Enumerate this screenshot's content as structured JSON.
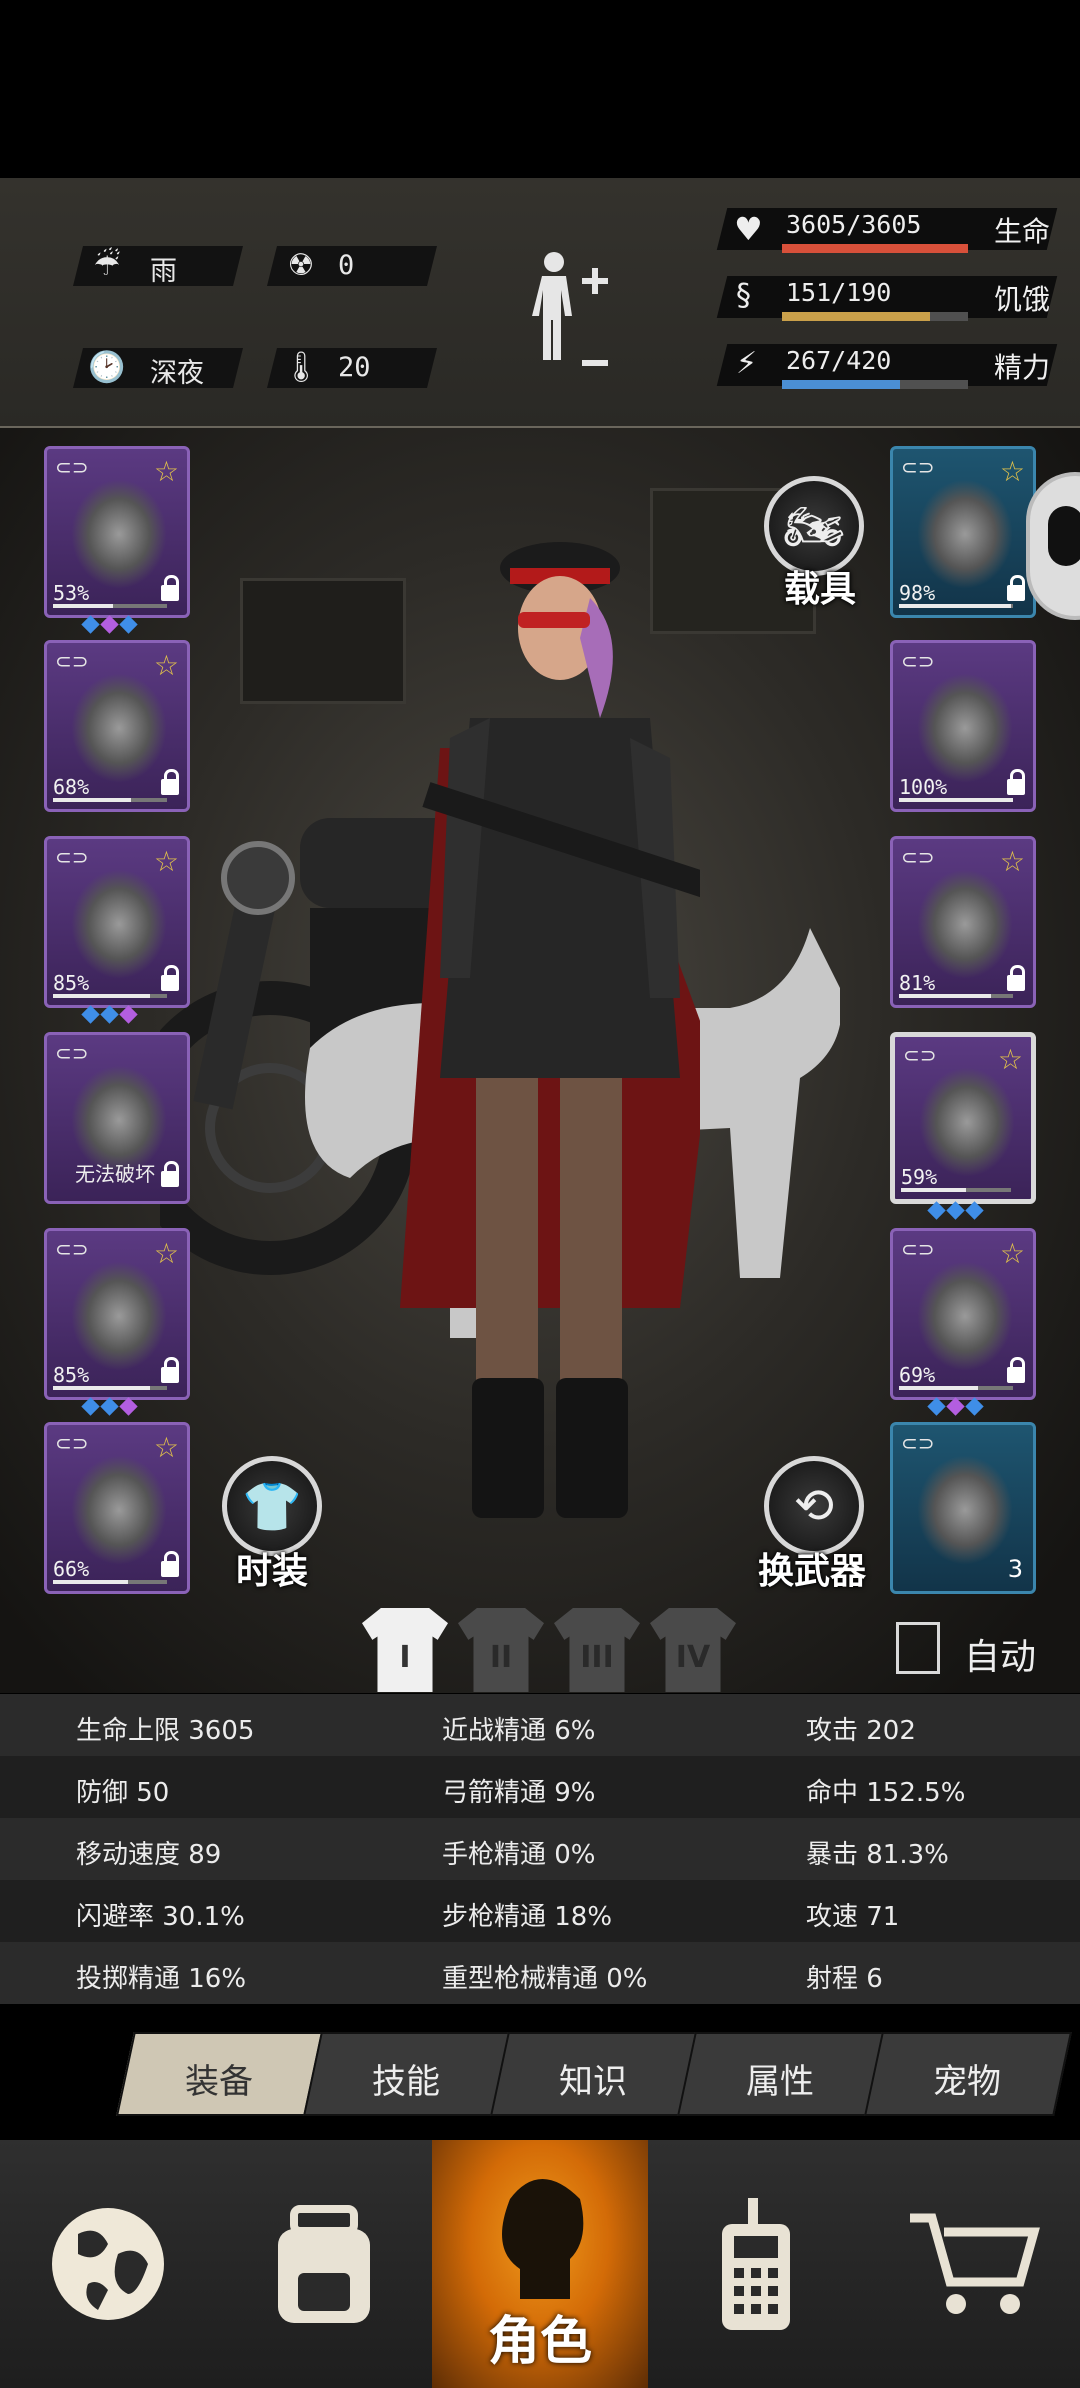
{
  "environment": {
    "weather": "雨",
    "radiation": "0",
    "time_of_day": "深夜",
    "temperature": "20"
  },
  "vitals": {
    "life": {
      "value": "3605/3605",
      "label": "生命",
      "fraction": 1.0,
      "color": "#d8503a"
    },
    "hunger": {
      "value": "151/190",
      "label": "饥饿",
      "fraction": 0.795,
      "color": "#caa04a"
    },
    "energy": {
      "value": "267/420",
      "label": "精力",
      "fraction": 0.636,
      "color": "#4b8fd4"
    }
  },
  "equipment_left": [
    {
      "name": "police-helmet",
      "pct": "53%",
      "durability": 0.53,
      "starred": true,
      "locked": true,
      "gems": [
        "b",
        "p",
        "b"
      ]
    },
    {
      "name": "jacket",
      "pct": "68%",
      "durability": 0.68,
      "starred": true,
      "locked": true,
      "gems": []
    },
    {
      "name": "coat",
      "pct": "85%",
      "durability": 0.85,
      "starred": true,
      "locked": true,
      "gems": [
        "b",
        "b",
        "p"
      ]
    },
    {
      "name": "backpack",
      "pct": "无法破坏",
      "durability": 1.0,
      "starred": false,
      "locked": true,
      "gems": []
    },
    {
      "name": "pants",
      "pct": "85%",
      "durability": 0.85,
      "starred": true,
      "locked": true,
      "gems": [
        "b",
        "b",
        "p"
      ]
    },
    {
      "name": "boots",
      "pct": "66%",
      "durability": 0.66,
      "starred": true,
      "locked": true,
      "gems": []
    }
  ],
  "equipment_right": [
    {
      "name": "sunglasses",
      "pct": "98%",
      "durability": 0.98,
      "starred": true,
      "locked": true,
      "gems": []
    },
    {
      "name": "gas-mask",
      "pct": "100%",
      "durability": 1.0,
      "starred": false,
      "locked": true,
      "gems": []
    },
    {
      "name": "tactical-vest",
      "pct": "81%",
      "durability": 0.81,
      "starred": true,
      "locked": true,
      "gems": []
    },
    {
      "name": "assault-rifle",
      "pct": "59%",
      "durability": 0.59,
      "starred": true,
      "locked": false,
      "gems": [
        "b",
        "b",
        "b"
      ]
    },
    {
      "name": "katana",
      "pct": "69%",
      "durability": 0.69,
      "starred": true,
      "locked": true,
      "gems": [
        "b",
        "p",
        "b"
      ]
    },
    {
      "name": "pouch",
      "count": "3"
    }
  ],
  "buttons": {
    "vehicle": "载具",
    "fashion": "时装",
    "swap_weapon": "换武器",
    "auto": "自动"
  },
  "loadouts": [
    "I",
    "II",
    "III",
    "IV"
  ],
  "stats": [
    [
      "生命上限 3605",
      "近战精通 6%",
      "攻击 202"
    ],
    [
      "防御 50",
      "弓箭精通 9%",
      "命中 152.5%"
    ],
    [
      "移动速度 89",
      "手枪精通 0%",
      "暴击 81.3%"
    ],
    [
      "闪避率 30.1%",
      "步枪精通 18%",
      "攻速 71"
    ],
    [
      "投掷精通 16%",
      "重型枪械精通 0%",
      "射程 6"
    ]
  ],
  "tabs": [
    "装备",
    "技能",
    "知识",
    "属性",
    "宠物"
  ],
  "nav": {
    "map": "map-icon",
    "backpack": "backpack-icon",
    "character": "角色",
    "radio": "radio-icon",
    "shop": "cart-icon"
  }
}
